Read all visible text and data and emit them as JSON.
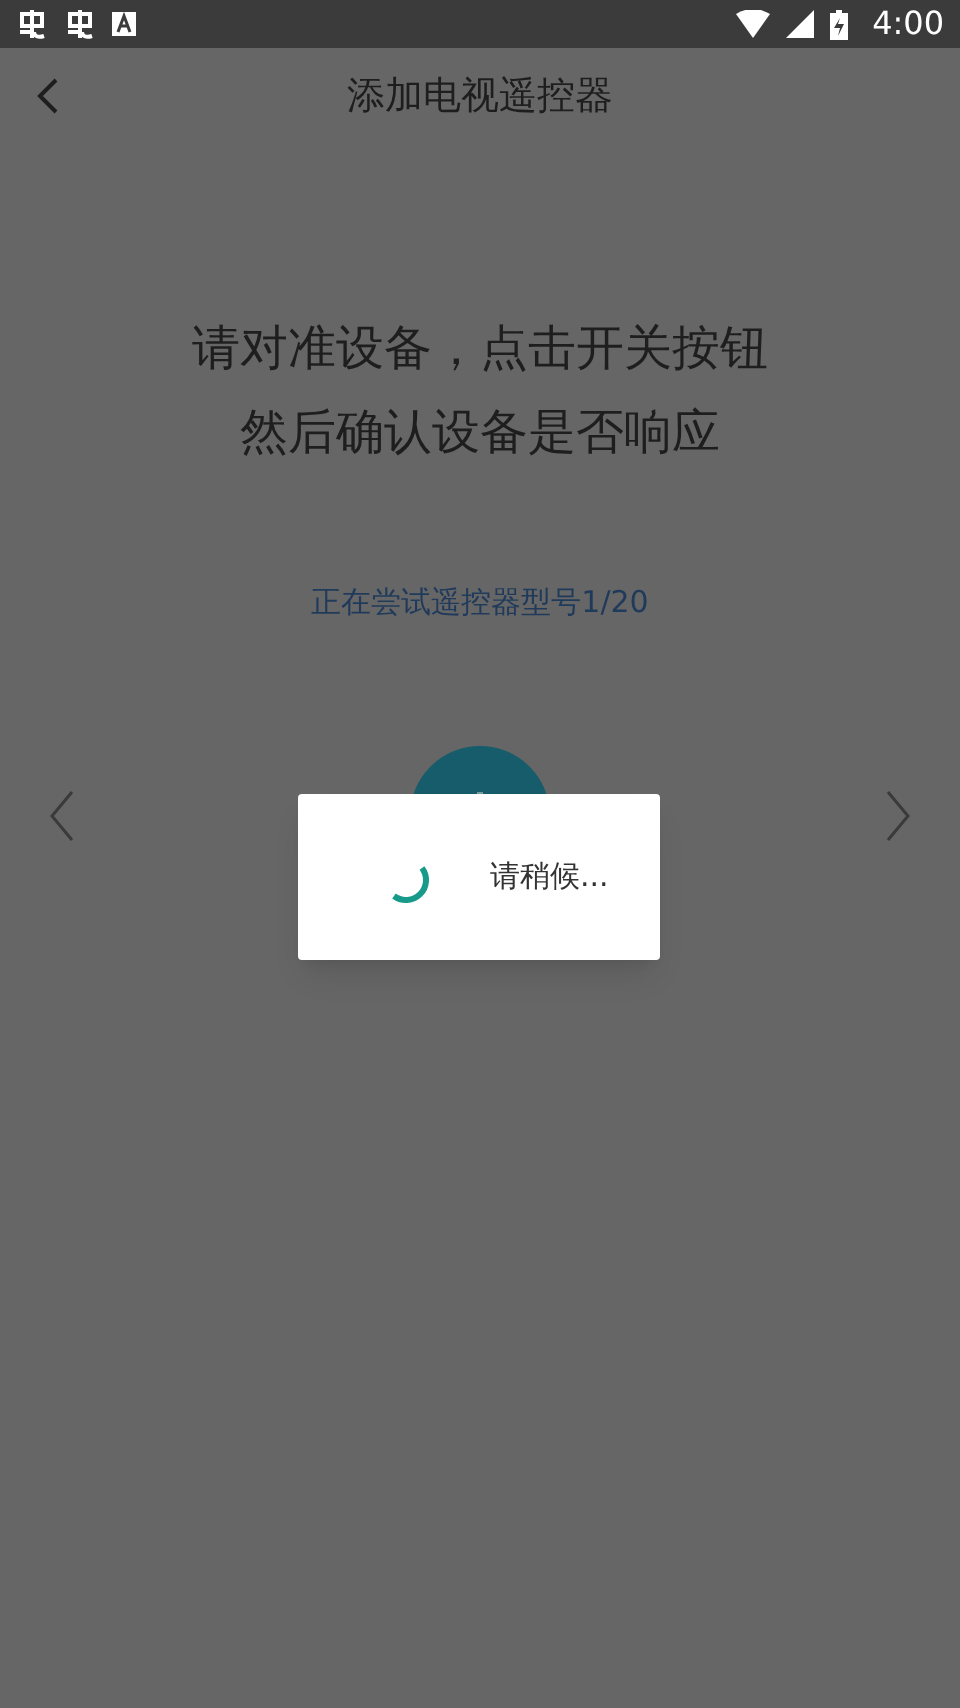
{
  "status_bar": {
    "time": "4:00"
  },
  "header": {
    "title": "添加电视遥控器"
  },
  "instruction": [
    "请对准设备，点击开关按钮",
    "然后确认设备是否响应"
  ],
  "progress_text": "正在尝试遥控器型号1/20",
  "dialog": {
    "message": "请稍候..."
  }
}
